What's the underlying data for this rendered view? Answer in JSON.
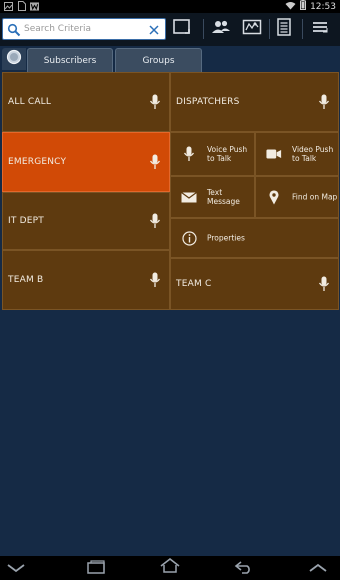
{
  "status_bar": {
    "time": "12:53",
    "left_icons": [
      "image-icon",
      "document-icon",
      "w-app-icon"
    ],
    "right_icons": [
      "wifi-icon",
      "battery-icon"
    ]
  },
  "action_bar": {
    "search": {
      "value": "",
      "placeholder": "Search Criteria"
    },
    "buttons": [
      "window-icon",
      "contacts-icon",
      "map-icon",
      "list-icon",
      "menu-icon"
    ]
  },
  "tabs": [
    {
      "label": "Subscribers",
      "active": false
    },
    {
      "label": "Groups",
      "active": false
    }
  ],
  "groups": [
    {
      "label": "ALL CALL"
    },
    {
      "label": "DISPATCHERS"
    },
    {
      "label": "EMERGENCY",
      "highlight_color": "#d14a06"
    },
    {
      "label": "IT DEPT"
    },
    {
      "label": "TEAM B"
    },
    {
      "label": "TEAM C"
    }
  ],
  "context_menu": {
    "voice_ptt": "Voice Push to Talk",
    "video_ptt": "Video Push to Talk",
    "text_message": "Text Message",
    "find_on_map": "Find on Map",
    "properties": "Properties"
  },
  "colors": {
    "background": "#152a45",
    "tile": "#5e3a0f",
    "emergency": "#d14a06"
  }
}
